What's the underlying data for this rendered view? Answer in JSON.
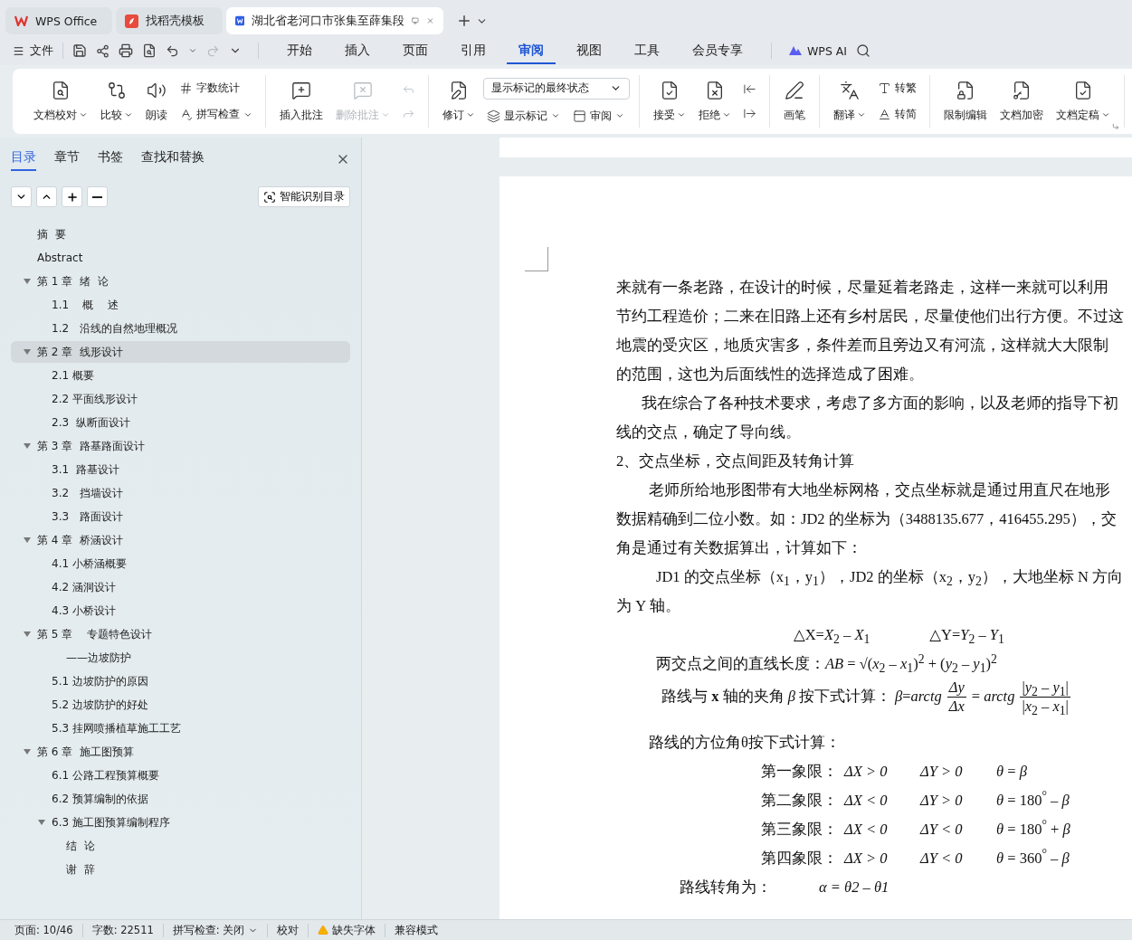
{
  "title_tabs": [
    {
      "kind": "home",
      "label": "WPS Office",
      "selected": false
    },
    {
      "kind": "template",
      "label": "找稻壳模板",
      "selected": false
    },
    {
      "kind": "doc",
      "label": "湖北省老河口市张集至薛集段",
      "selected": true
    }
  ],
  "menu": {
    "file": "文件",
    "tabs": [
      {
        "label": "开始",
        "selected": false
      },
      {
        "label": "插入",
        "selected": false
      },
      {
        "label": "页面",
        "selected": false
      },
      {
        "label": "引用",
        "selected": false
      },
      {
        "label": "审阅",
        "selected": true
      },
      {
        "label": "视图",
        "selected": false
      },
      {
        "label": "工具",
        "selected": false
      },
      {
        "label": "会员专享",
        "selected": false
      }
    ],
    "ai": "WPS AI"
  },
  "ribbon": [
    {
      "items": [
        {
          "kind": "large",
          "label": "文档校对",
          "dropdown": true,
          "disabled": false
        },
        {
          "kind": "large",
          "label": "比较",
          "dropdown": true,
          "disabled": false
        },
        {
          "kind": "large",
          "label": "朗读",
          "dropdown": false,
          "disabled": false
        },
        {
          "kind": "small",
          "label": "字数统计",
          "dropdown": false,
          "disabled": false
        },
        {
          "kind": "small",
          "label": "拼写检查",
          "dropdown": true,
          "disabled": false
        }
      ]
    },
    {
      "items": [
        {
          "kind": "large",
          "label": "插入批注",
          "dropdown": false,
          "disabled": false
        },
        {
          "kind": "large",
          "label": "删除批注",
          "dropdown": true,
          "disabled": true
        },
        {
          "kind": "icon",
          "disabled": true
        },
        {
          "kind": "icon",
          "disabled": true
        }
      ]
    },
    {
      "items": [
        {
          "kind": "large",
          "label": "修订",
          "dropdown": true,
          "disabled": false
        },
        {
          "kind": "select",
          "label": "显示标记的最终状态"
        },
        {
          "kind": "small",
          "label": "显示标记",
          "dropdown": true,
          "disabled": false
        },
        {
          "kind": "small",
          "label": "审阅",
          "dropdown": true,
          "disabled": false
        }
      ]
    },
    {
      "items": [
        {
          "kind": "large",
          "label": "接受",
          "dropdown": true,
          "disabled": false
        },
        {
          "kind": "large",
          "label": "拒绝",
          "dropdown": true,
          "disabled": false
        },
        {
          "kind": "icon",
          "disabled": false
        },
        {
          "kind": "icon",
          "disabled": false
        }
      ]
    },
    {
      "items": [
        {
          "kind": "large",
          "label": "画笔",
          "dropdown": false,
          "disabled": false
        }
      ]
    },
    {
      "items": [
        {
          "kind": "large",
          "label": "翻译",
          "dropdown": true,
          "disabled": false
        },
        {
          "kind": "small",
          "label": "转繁",
          "dropdown": false,
          "disabled": false
        },
        {
          "kind": "small",
          "label": "转简",
          "dropdown": false,
          "disabled": false
        }
      ]
    },
    {
      "items": [
        {
          "kind": "large",
          "label": "限制编辑",
          "dropdown": false,
          "disabled": false
        },
        {
          "kind": "large",
          "label": "文档加密",
          "dropdown": false,
          "disabled": false
        },
        {
          "kind": "large",
          "label": "文档定稿",
          "dropdown": true,
          "disabled": false
        }
      ]
    }
  ],
  "sidebar": {
    "tabs": [
      {
        "label": "目录",
        "selected": true
      },
      {
        "label": "章节",
        "selected": false
      },
      {
        "label": "书签",
        "selected": false
      },
      {
        "label": "查找和替换",
        "selected": false
      }
    ],
    "smart_button": "智能识别目录",
    "toc": [
      {
        "label": "摘  要",
        "selected": false
      },
      {
        "label": "Abstract",
        "selected": false
      },
      {
        "label": "第 1 章  绪  论",
        "selected": false,
        "expanded": true,
        "children": [
          {
            "label": "1.1    概    述",
            "selected": false
          },
          {
            "label": "1.2   沿线的自然地理概况",
            "selected": false
          }
        ]
      },
      {
        "label": "第 2 章  线形设计",
        "selected": true,
        "expanded": true,
        "children": [
          {
            "label": "2.1 概要",
            "selected": false
          },
          {
            "label": "2.2 平面线形设计",
            "selected": false
          },
          {
            "label": "2.3  纵断面设计",
            "selected": false
          }
        ]
      },
      {
        "label": "第 3 章  路基路面设计",
        "selected": false,
        "expanded": true,
        "children": [
          {
            "label": "3.1  路基设计",
            "selected": false
          },
          {
            "label": "3.2   挡墙设计",
            "selected": false
          },
          {
            "label": "3.3   路面设计",
            "selected": false
          }
        ]
      },
      {
        "label": "第 4 章  桥涵设计",
        "selected": false,
        "expanded": true,
        "children": [
          {
            "label": "4.1 小桥涵概要",
            "selected": false
          },
          {
            "label": "4.2 涵洞设计",
            "selected": false
          },
          {
            "label": "4.3 小桥设计",
            "selected": false
          }
        ]
      },
      {
        "label": "第 5 章    专题特色设计",
        "selected": false,
        "expanded": true,
        "children": [
          {
            "label": "——边坡防护",
            "selected": false,
            "kind": "sub"
          },
          {
            "label": "5.1 边坡防护的原因",
            "selected": false,
            "kind": "item"
          },
          {
            "label": "5.2 边坡防护的好处",
            "selected": false,
            "kind": "item"
          },
          {
            "label": "5.3 挂网喷播植草施工工艺",
            "selected": false,
            "kind": "item"
          }
        ]
      },
      {
        "label": "第 6 章  施工图预算",
        "selected": false,
        "expanded": true,
        "children": [
          {
            "label": "6.1 公路工程预算概要",
            "selected": false
          },
          {
            "label": "6.2 预算编制的依据",
            "selected": false
          },
          {
            "label": "6.3 施工图预算编制程序",
            "selected": false,
            "expanded": true,
            "children": [
              {
                "label": "结  论",
                "selected": false
              },
              {
                "label": "谢  辞",
                "selected": false
              }
            ]
          }
        ]
      }
    ]
  },
  "document": {
    "lines": [
      {
        "kind": "plain",
        "text": "来就有一条老路，在设计的时候，尽量延着老路走，这样一来就可以利用"
      },
      {
        "kind": "plain",
        "text": "节约工程造价；二来在旧路上还有乡村居民，尽量使他们出行方便。不过这"
      },
      {
        "kind": "plain",
        "text": "地震的受灾区，地质灾害多，条件差而且旁边又有河流，这样就大大限制"
      },
      {
        "kind": "plain",
        "text": "的范围，这也为后面线性的选择造成了困难。"
      },
      {
        "kind": "indent",
        "text": "我在综合了各种技术要求，考虑了多方面的影响，以及老师的指导下初"
      },
      {
        "kind": "plain",
        "text": "线的交点，确定了导向线。"
      },
      {
        "kind": "plain",
        "text": "2、交点坐标，交点间距及转角计算"
      },
      {
        "kind": "deep",
        "text": "老师所给地形图带有大地坐标网格，交点坐标就是通过用直尺在地形"
      },
      {
        "kind": "plain",
        "text": "数据精确到二位小数。如：JD2 的坐标为（3488135.677，416455.295），交"
      },
      {
        "kind": "plain",
        "text": "角是通过有关数据算出，计算如下："
      },
      {
        "kind": "deeper",
        "text": "JD1 的交点坐标（x$_{1}$，y$_{1}$），JD2 的坐标（x$_{2}$，y$_{2}$），大地坐标 N 方向"
      },
      {
        "kind": "plain",
        "text": "为 Y 轴。"
      }
    ],
    "deltas": [
      "△X=*X*$_{2}$ – *X*$_{1}$",
      "△Y=*Y*$_{2}$ – *Y*$_{1}$"
    ],
    "distance": {
      "label": "两交点之间的直线长度：",
      "formula": "*AB* = √(*x*$_{2}$ – *x*$_{1}$)$^{2}$ + (*y*$_{2}$ – *y*$_{1}$)$^{2}$"
    },
    "angle": {
      "label": "路线与 **x** 轴的夹角 *β* 按下式计算：",
      "lhs": "*β*=*arctg*",
      "frac1": {
        "num": "Δy",
        "den": "Δx"
      },
      "mid": "= *arctg*",
      "frac2": {
        "num": "|*y*$_{2}$ – *y*$_{1}$|",
        "den": "|*x*$_{2}$ – *x*$_{1}$|"
      }
    },
    "azimuth_label": "路线的方位角θ按下式计算：",
    "quadrants": [
      {
        "label": "第一象限：",
        "dx": "ΔX > 0",
        "dy": "ΔY > 0",
        "theta": "*θ* = *β*"
      },
      {
        "label": "第二象限：",
        "dx": "ΔX < 0",
        "dy": "ΔY > 0",
        "theta": "*θ* = 180$^{°}$ – *β*"
      },
      {
        "label": "第三象限：",
        "dx": "ΔX < 0",
        "dy": "ΔY < 0",
        "theta": "*θ* = 180$^{°}$ + *β*"
      },
      {
        "label": "第四象限：",
        "dx": "ΔX > 0",
        "dy": "ΔY < 0",
        "theta": "*θ* = 360$^{°}$ – *β*"
      }
    ],
    "turn": {
      "label": "路线转角为：",
      "formula": "α = θ2 – θ1"
    }
  },
  "status_bar": [
    {
      "kind": "text",
      "text": "页面: 10/46"
    },
    {
      "kind": "text",
      "text": "字数: 22511"
    },
    {
      "kind": "dropdown",
      "text": "拼写检查: 关闭"
    },
    {
      "kind": "text",
      "text": "校对"
    },
    {
      "kind": "warning",
      "text": "缺失字体"
    },
    {
      "kind": "text",
      "text": "兼容模式"
    }
  ]
}
